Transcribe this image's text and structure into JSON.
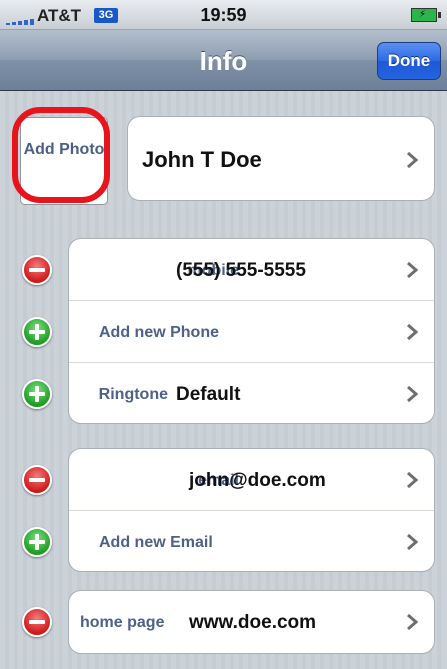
{
  "status_bar": {
    "carrier": "AT&T",
    "network": "3G",
    "time": "19:59",
    "icons": [
      "signal-bars-icon",
      "battery-charging-icon"
    ]
  },
  "nav": {
    "title": "Info",
    "done_label": "Done"
  },
  "photo": {
    "label": "Add Photo"
  },
  "contact": {
    "name": "John T Doe"
  },
  "phone_section": {
    "rows": [
      {
        "action": "delete",
        "label": "mobile",
        "value": "(555) 555-5555"
      },
      {
        "action": "add",
        "label": "Add new Phone",
        "value": ""
      },
      {
        "action": "add",
        "label": "Ringtone",
        "value": "Default"
      }
    ]
  },
  "email_section": {
    "rows": [
      {
        "action": "delete",
        "label": "email",
        "value": "john@doe.com"
      },
      {
        "action": "add",
        "label": "Add new Email",
        "value": ""
      }
    ]
  },
  "url_section": {
    "rows": [
      {
        "action": "delete",
        "label": "home page",
        "value": "www.doe.com"
      }
    ]
  },
  "colors": {
    "delete": "#d01a1a",
    "add": "#1e9c25",
    "label": "#4d6189",
    "highlight": "#e8141b",
    "done_button": "#2e6ae6"
  }
}
